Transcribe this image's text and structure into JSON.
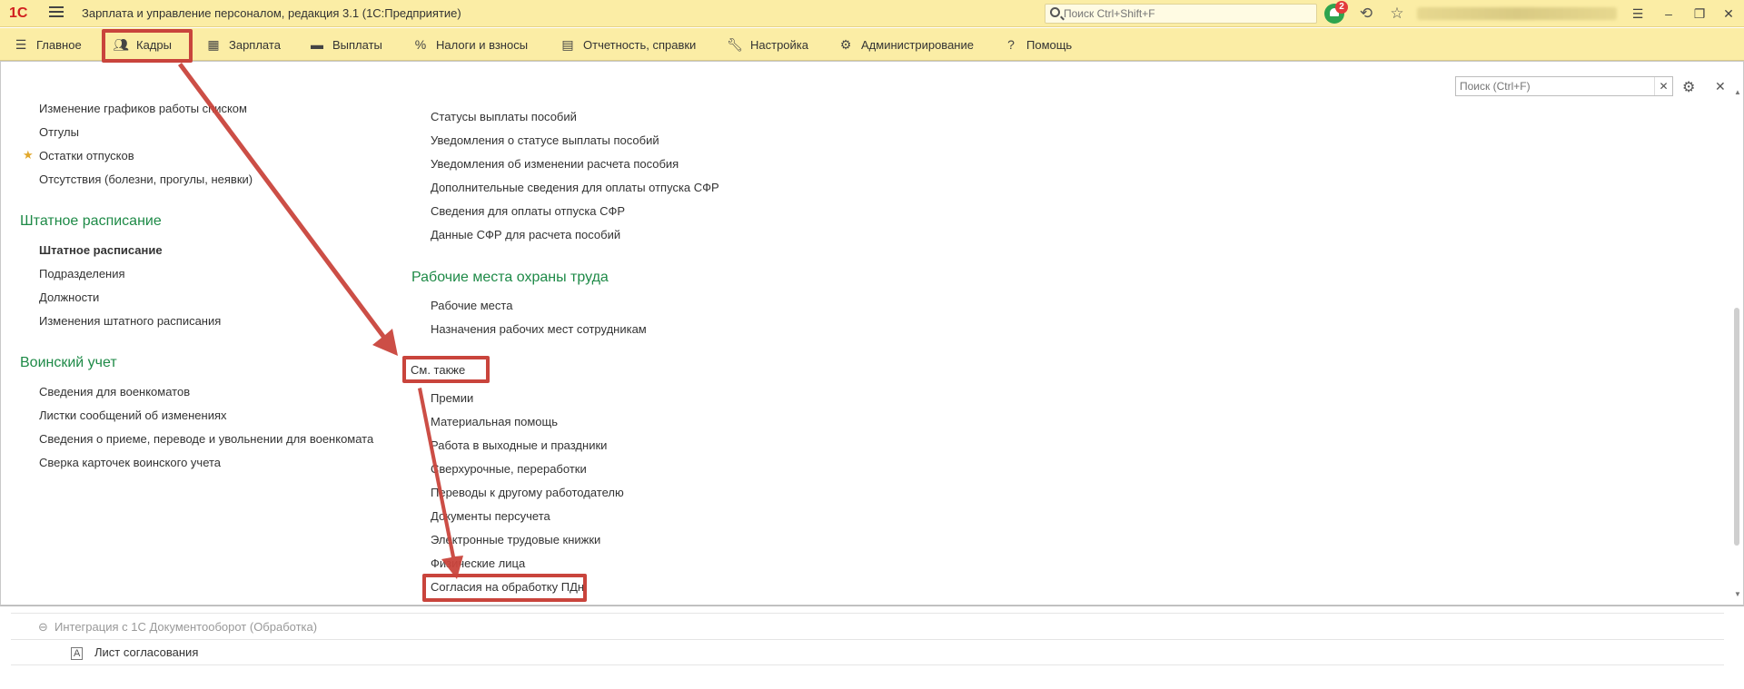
{
  "titlebar": {
    "logo": "1С",
    "app_title": "Зарплата и управление персоналом, редакция 3.1  (1С:Предприятие)",
    "search_placeholder": "Поиск Ctrl+Shift+F",
    "notif_count": "2"
  },
  "menu": {
    "items": [
      {
        "label": "Главное",
        "icon": "hamburger-icon"
      },
      {
        "label": "Кадры",
        "icon": "people-icon"
      },
      {
        "label": "Зарплата",
        "icon": "calculator-icon"
      },
      {
        "label": "Выплаты",
        "icon": "wallet-icon"
      },
      {
        "label": "Налоги и взносы",
        "icon": "percent-icon"
      },
      {
        "label": "Отчетность, справки",
        "icon": "reports-icon"
      },
      {
        "label": "Настройка",
        "icon": "wrench-icon"
      },
      {
        "label": "Администрирование",
        "icon": "gear-icon"
      },
      {
        "label": "Помощь",
        "icon": "question-icon"
      }
    ]
  },
  "panel": {
    "search_placeholder": "Поиск (Ctrl+F)",
    "left": {
      "top_links": [
        "Изменение графиков работы списком",
        "Отгулы",
        "Остатки отпусков",
        "Отсутствия (болезни, прогулы, неявки)"
      ],
      "staff_title": "Штатное расписание",
      "staff_links": [
        "Штатное расписание",
        "Подразделения",
        "Должности",
        "Изменения штатного расписания"
      ],
      "military_title": "Воинский учет",
      "military_links": [
        "Сведения для военкоматов",
        "Листки сообщений об изменениях",
        "Сведения о приеме, переводе и увольнении для военкомата",
        "Сверка карточек воинского учета"
      ]
    },
    "right": {
      "top_links": [
        "Статусы выплаты пособий",
        "Уведомления о статусе выплаты пособий",
        "Уведомления об изменении расчета пособия",
        "Дополнительные сведения для оплаты отпуска СФР",
        "Сведения для оплаты отпуска СФР",
        "Данные СФР для расчета пособий"
      ],
      "safety_title": "Рабочие места охраны труда",
      "safety_links": [
        "Рабочие места",
        "Назначения рабочих мест сотрудникам"
      ],
      "see_also": "См. также",
      "see_also_links": [
        "Премии",
        "Материальная помощь",
        "Работа в выходные и праздники",
        "Сверхурочные, переработки",
        "Переводы к другому работодателю",
        "Документы персучета",
        "Электронные трудовые книжки",
        "Физические лица",
        "Согласия на обработку ПДн"
      ]
    }
  },
  "bottom": {
    "rows": [
      "Интеграция с 1С Документооборот (Обработка)",
      "Лист согласования"
    ]
  },
  "colors": {
    "accent_yellow": "#fbeda5",
    "section_green": "#1e8a47",
    "highlight_red": "#c9443c"
  }
}
